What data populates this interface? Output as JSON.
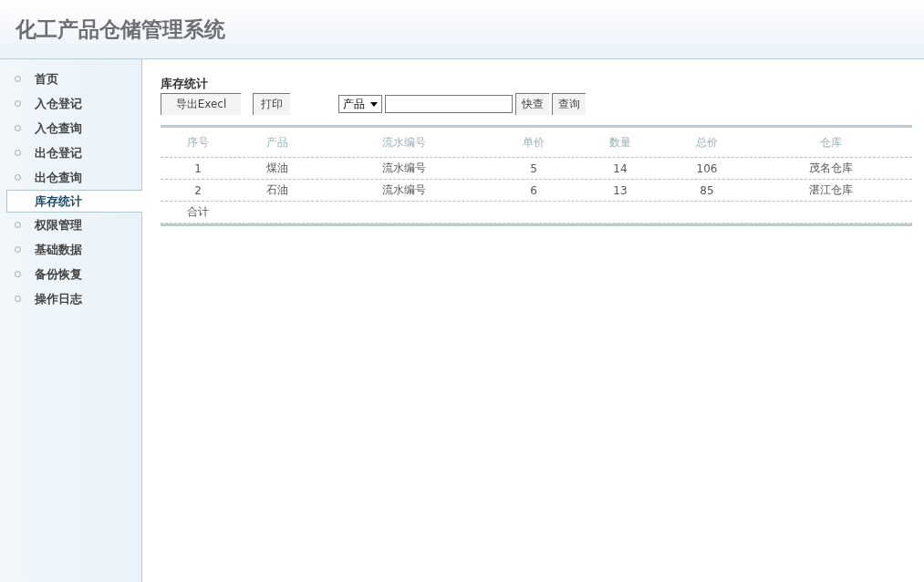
{
  "header": {
    "title": "化工产品仓储管理系统"
  },
  "sidebar": {
    "items": [
      {
        "label": "首页",
        "selected": false
      },
      {
        "label": "入仓登记",
        "selected": false
      },
      {
        "label": "入仓查询",
        "selected": false
      },
      {
        "label": "出仓登记",
        "selected": false
      },
      {
        "label": "出仓查询",
        "selected": false
      },
      {
        "label": "库存统计",
        "selected": true
      },
      {
        "label": "权限管理",
        "selected": false
      },
      {
        "label": "基础数据",
        "selected": false
      },
      {
        "label": "备份恢复",
        "selected": false
      },
      {
        "label": "操作日志",
        "selected": false
      }
    ]
  },
  "content": {
    "title": "库存统计",
    "toolbar": {
      "export_button": "导出Execl",
      "print_button": "打印",
      "filter_select": "产品",
      "quick_button": "快查",
      "query_button": "查询"
    },
    "table": {
      "columns": [
        "序号",
        "产品",
        "流水编号",
        "单价",
        "数量",
        "总价",
        "仓库"
      ],
      "rows": [
        [
          "1",
          "煤油",
          "流水编号",
          "5",
          "14",
          "106",
          "茂名仓库"
        ],
        [
          "2",
          "石油",
          "流水编号",
          "6",
          "13",
          "85",
          "湛江仓库"
        ]
      ],
      "total_label": "合计"
    }
  }
}
